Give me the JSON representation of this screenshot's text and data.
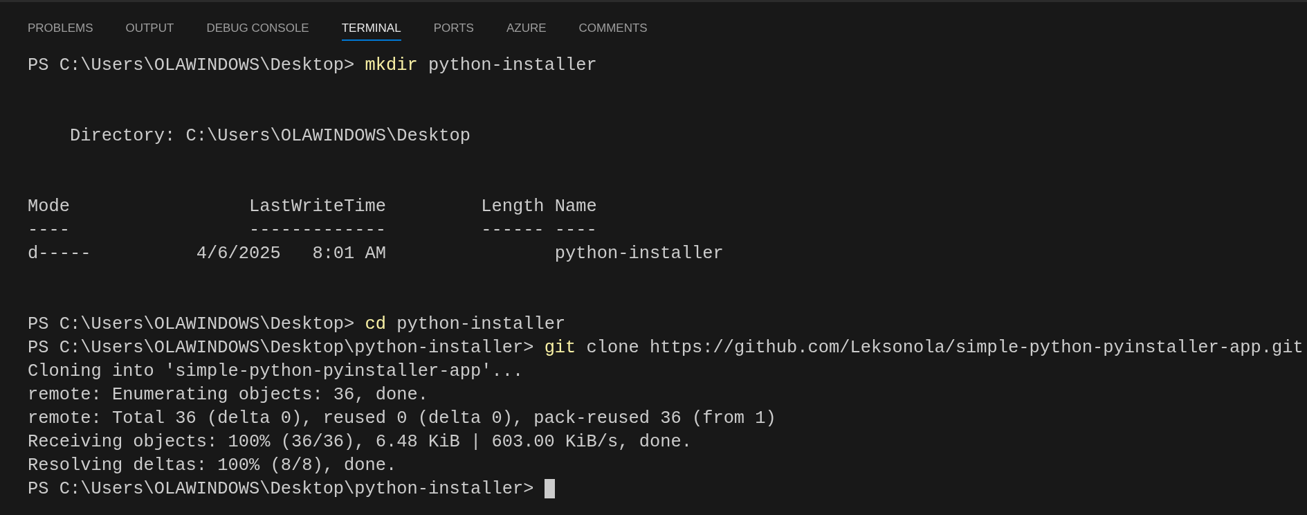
{
  "tabs": [
    {
      "label": "PROBLEMS",
      "selected": false
    },
    {
      "label": "OUTPUT",
      "selected": false
    },
    {
      "label": "DEBUG CONSOLE",
      "selected": false
    },
    {
      "label": "TERMINAL",
      "selected": true
    },
    {
      "label": "PORTS",
      "selected": false
    },
    {
      "label": "AZURE",
      "selected": false
    },
    {
      "label": "COMMENTS",
      "selected": false
    }
  ],
  "terminal": {
    "blocks": [
      [
        {
          "kind": "prompt",
          "prompt": "PS C:\\Users\\OLAWINDOWS\\Desktop>",
          "command": "mkdir",
          "args": "python-installer"
        }
      ],
      [
        {
          "kind": "indented",
          "text": "Directory: C:\\Users\\OLAWINDOWS\\Desktop"
        }
      ],
      [
        {
          "kind": "output",
          "text": "Mode                 LastWriteTime         Length Name"
        },
        {
          "kind": "output",
          "text": "----                 -------------         ------ ----"
        },
        {
          "kind": "output",
          "text": "d-----          4/6/2025   8:01 AM                python-installer"
        }
      ],
      [
        {
          "kind": "prompt",
          "prompt": "PS C:\\Users\\OLAWINDOWS\\Desktop>",
          "command": "cd",
          "args": "python-installer"
        },
        {
          "kind": "prompt",
          "prompt": "PS C:\\Users\\OLAWINDOWS\\Desktop\\python-installer>",
          "command": "git",
          "args": "clone https://github.com/Leksonola/simple-python-pyinstaller-app.git"
        },
        {
          "kind": "output",
          "text": "Cloning into 'simple-python-pyinstaller-app'..."
        },
        {
          "kind": "output",
          "text": "remote: Enumerating objects: 36, done."
        },
        {
          "kind": "output",
          "text": "remote: Total 36 (delta 0), reused 0 (delta 0), pack-reused 36 (from 1)"
        },
        {
          "kind": "output",
          "text": "Receiving objects: 100% (36/36), 6.48 KiB | 603.00 KiB/s, done."
        },
        {
          "kind": "output",
          "text": "Resolving deltas: 100% (8/8), done."
        },
        {
          "kind": "cursor",
          "prompt": "PS C:\\Users\\OLAWINDOWS\\Desktop\\python-installer>"
        }
      ]
    ]
  }
}
